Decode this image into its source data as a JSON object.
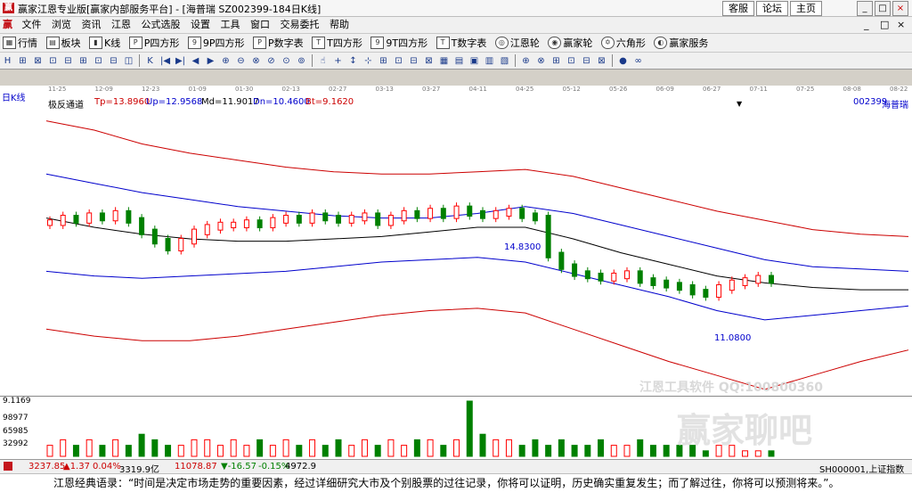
{
  "window": {
    "title": "赢家江恩专业版[赢家内部服务平台] - [海普瑞  SZ002399-184日K线]",
    "logo_char": "赢",
    "links": [
      "客服",
      "论坛",
      "主页"
    ],
    "controls": [
      "_",
      "□",
      "×"
    ]
  },
  "menu": {
    "items": [
      "文件",
      "浏览",
      "资讯",
      "江恩",
      "公式选股",
      "设置",
      "工具",
      "窗口",
      "交易委托",
      "帮助"
    ],
    "right_controls": [
      "_",
      "□",
      "×"
    ]
  },
  "toolbar": {
    "items": [
      {
        "icon": "grid-icon",
        "label": "行情"
      },
      {
        "icon": "blocks-icon",
        "label": "板块"
      },
      {
        "icon": "kline-icon",
        "label": "K线"
      },
      {
        "icon": "p-square-icon",
        "label": "P四方形"
      },
      {
        "icon": "9p-square-icon",
        "label": "9P四方形"
      },
      {
        "icon": "p-number-icon",
        "label": "P数字表"
      },
      {
        "icon": "t-square-icon",
        "label": "T四方形"
      },
      {
        "icon": "9t-square-icon",
        "label": "9T四方形"
      },
      {
        "icon": "t-number-icon",
        "label": "T数字表"
      },
      {
        "icon": "gann-wheel-icon",
        "label": "江恩轮"
      },
      {
        "icon": "winner-wheel-icon",
        "label": "赢家轮"
      },
      {
        "icon": "hexagon-icon",
        "label": "六角形"
      },
      {
        "icon": "service-icon",
        "label": "赢家服务"
      }
    ],
    "tools": [
      "H",
      "⊞",
      "⊠",
      "⊡",
      "⊟",
      "⊞",
      "⊡",
      "⊟",
      "◫",
      "K",
      "|◀",
      "▶|",
      "◀",
      "▶",
      "⊕",
      "⊖",
      "⊗",
      "⊘",
      "⊙",
      "⊚",
      "☝",
      "+",
      "↕",
      "⊹",
      "⊞",
      "⊡",
      "⊟",
      "⊠",
      "▦",
      "▤",
      "▣",
      "▥",
      "▧",
      "⊕",
      "⊗",
      "⊞",
      "⊡",
      "⊟",
      "⊠",
      "●",
      "∞"
    ]
  },
  "chart": {
    "period_label": "日K线",
    "dates": [
      "11-25",
      "12-09",
      "12-23",
      "01-09",
      "01-30",
      "02-13",
      "02-27",
      "03-13",
      "03-27",
      "04-11",
      "04-25",
      "05-12",
      "05-26",
      "06-09",
      "06-27",
      "07-11",
      "07-25",
      "08-08",
      "08-22"
    ],
    "indicator": {
      "name": "极反通道",
      "tp": "Tp=13.8960",
      "up": "Up=12.9568",
      "md": "Md=11.9017",
      "dn": "Dn=10.4600",
      "bt": "Bt=9.1620"
    },
    "stock_code": "002399",
    "stock_name": "海普瑞",
    "high_label": "14.8300",
    "low_label": "11.0800",
    "volume_axis": [
      "9.1169",
      "98977",
      "65985",
      "32992"
    ],
    "watermark_line1": "江恩工具软件  QQ:100800360",
    "watermark_line2": "赢家聊吧",
    "colors": {
      "up": "#ff0000",
      "down": "#008000",
      "upper_band": "#cc0000",
      "mid_band": "#0000cc",
      "center": "#000000"
    }
  },
  "status": {
    "sh_value": "3237.85",
    "sh_change": "▲1.37",
    "sh_pct": "0.04%",
    "sh_amount": "3319.9亿",
    "sz_value": "11078.87",
    "sz_change": "▼-16.57",
    "sz_pct": "-0.15%",
    "sz_amount": "4972.9",
    "index_code": "SH000001,上证指数"
  },
  "footer": {
    "quote": "江恩经典语录：“时间是决定市场走势的重要因素，经过详细研究大市及个别股票的过往记录，你将可以证明，历史确实重复发生；而了解过往，你将可以预测将来。”。"
  },
  "chart_data": {
    "type": "line",
    "title": "",
    "xlabel": "",
    "ylabel": "",
    "x": [
      "11-25",
      "12-09",
      "12-23",
      "01-09",
      "01-30",
      "02-13",
      "02-27",
      "03-13",
      "03-27",
      "04-11",
      "04-25",
      "05-12",
      "05-26",
      "06-09",
      "06-27",
      "07-11",
      "07-25",
      "08-08",
      "08-22"
    ],
    "series": [
      {
        "name": "Tp",
        "values": [
          18.6,
          18.2,
          17.6,
          17.2,
          16.9,
          16.6,
          16.4,
          16.3,
          16.3,
          16.4,
          16.5,
          16.2,
          15.7,
          15.2,
          14.7,
          14.3,
          13.9,
          13.7,
          13.6
        ]
      },
      {
        "name": "Up",
        "values": [
          16.3,
          15.9,
          15.5,
          15.2,
          14.9,
          14.7,
          14.5,
          14.4,
          14.4,
          14.6,
          14.9,
          14.6,
          14.1,
          13.6,
          13.1,
          12.6,
          12.3,
          12.2,
          12.1
        ]
      },
      {
        "name": "Md",
        "values": [
          14.4,
          14.0,
          13.7,
          13.5,
          13.4,
          13.4,
          13.5,
          13.6,
          13.8,
          14.0,
          14.0,
          13.5,
          12.9,
          12.4,
          11.9,
          11.6,
          11.4,
          11.3,
          11.3
        ]
      },
      {
        "name": "Dn",
        "values": [
          12.1,
          11.9,
          11.8,
          11.9,
          12.0,
          12.1,
          12.3,
          12.5,
          12.6,
          12.7,
          12.5,
          12.0,
          11.5,
          11.0,
          10.4,
          10.0,
          10.2,
          10.4,
          10.6
        ]
      },
      {
        "name": "Bt",
        "values": [
          9.6,
          9.3,
          9.1,
          9.1,
          9.3,
          9.6,
          9.9,
          10.2,
          10.4,
          10.5,
          10.3,
          9.6,
          8.9,
          8.2,
          7.6,
          7.0,
          7.6,
          8.2,
          8.7
        ]
      }
    ],
    "candles": [
      14.2,
      14.4,
      14.3,
      14.5,
      14.4,
      14.6,
      14.3,
      13.8,
      13.4,
      13.1,
      13.4,
      13.8,
      14.0,
      14.1,
      14.1,
      14.2,
      14.1,
      14.3,
      14.4,
      14.3,
      14.5,
      14.4,
      14.3,
      14.4,
      14.5,
      14.2,
      14.4,
      14.6,
      14.5,
      14.7,
      14.5,
      14.8,
      14.6,
      14.5,
      14.6,
      14.7,
      14.5,
      14.4,
      12.8,
      12.3,
      12.0,
      11.9,
      11.8,
      11.9,
      12.0,
      11.7,
      11.6,
      11.5,
      11.4,
      11.2,
      11.1,
      11.4,
      11.6,
      11.7,
      11.8,
      11.7
    ],
    "volume": [
      2,
      3,
      2,
      3,
      2,
      3,
      2,
      4,
      3,
      2,
      2,
      3,
      3,
      2,
      3,
      2,
      3,
      2,
      3,
      2,
      3,
      2,
      3,
      2,
      3,
      2,
      3,
      2,
      3,
      3,
      2,
      3,
      10,
      4,
      3,
      3,
      2,
      3,
      2,
      3,
      2,
      2,
      3,
      2,
      2,
      3,
      2,
      2,
      2,
      2,
      1,
      2,
      2,
      1,
      1,
      1
    ],
    "ylim": [
      6.8,
      19.2
    ],
    "grid": false
  }
}
